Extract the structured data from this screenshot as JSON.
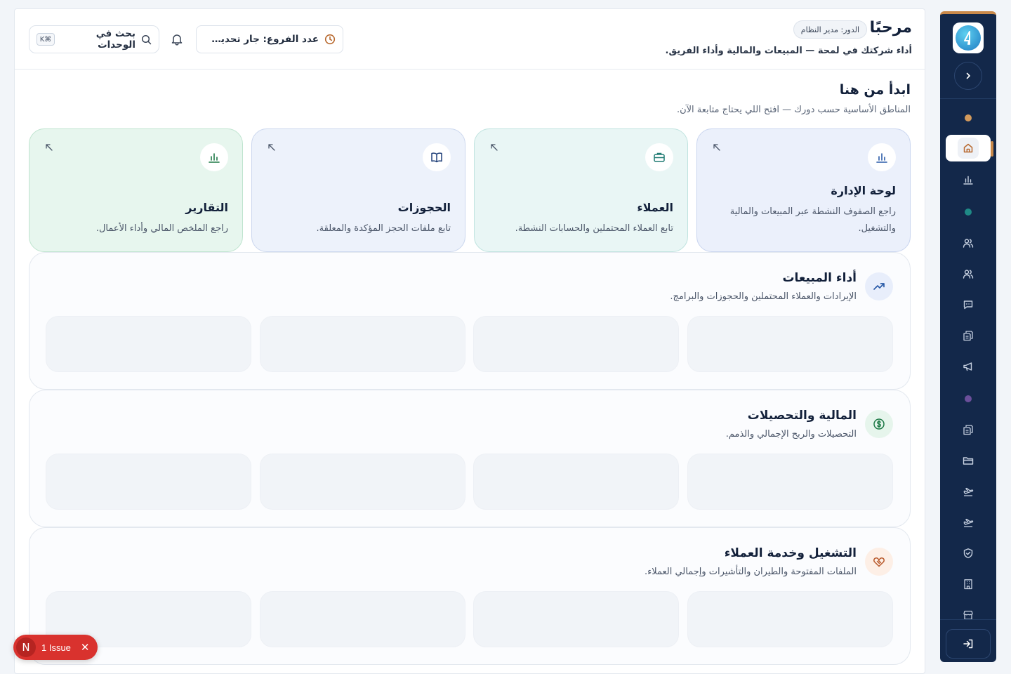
{
  "header": {
    "title": "مرحبًا",
    "role_badge": "الدور: مدير النظام",
    "subtitle": "أداء شركتك في لمحة — المبيعات والمالية وأداء الفريق.",
    "branch_label": "عدد الفروع: جار تحديث البيانات",
    "search_label": "بحث في الوحدات",
    "search_kbd": "K⌘"
  },
  "start": {
    "title": "ابدأ من هنا",
    "subtitle": "المناطق الأساسية حسب دورك — افتح اللي يحتاج متابعة الآن."
  },
  "cards": [
    {
      "title": "لوحة الإدارة",
      "desc": "راجع الصفوف النشطة عبر المبيعات والمالية والتشغيل.",
      "icon": "bar-chart-icon",
      "bg": "#ebf0fb",
      "border": "#c9d5ef"
    },
    {
      "title": "العملاء",
      "desc": "تابع العملاء المحتملين والحسابات النشطة.",
      "icon": "briefcase-icon",
      "bg": "#e9f6f5",
      "border": "#bfe3df"
    },
    {
      "title": "الحجوزات",
      "desc": "تابع ملفات الحجز المؤكدة والمعلقة.",
      "icon": "book-icon",
      "bg": "#edf2fb",
      "border": "#cbd7ee"
    },
    {
      "title": "التقارير",
      "desc": "راجع الملخص المالي وأداء الأعمال.",
      "icon": "bar-chart-icon",
      "bg": "#e7f6ee",
      "border": "#bfe4cf"
    }
  ],
  "groups": [
    {
      "title": "أداء المبيعات",
      "subtitle": "الإيرادات والعملاء المحتملين والحجوزات والبرامج.",
      "icon": "trending-up-icon",
      "icon_bg": "#e8eefb",
      "icon_color": "#2b5ca8"
    },
    {
      "title": "المالية والتحصيلات",
      "subtitle": "التحصيلات والربح الإجمالي والذمم.",
      "icon": "dollar-icon",
      "icon_bg": "#e6f5ec",
      "icon_color": "#1e7a47"
    },
    {
      "title": "التشغيل وخدمة العملاء",
      "subtitle": "الملفات المفتوحة والطيران والتأشيرات وإجمالي العملاء.",
      "icon": "handshake-icon",
      "icon_bg": "#fdefe6",
      "icon_color": "#b8582a"
    }
  ],
  "issue": {
    "letter": "N",
    "label": "1 Issue"
  },
  "colors": {
    "sidebar": "#13284a",
    "accent": "#c9894a"
  }
}
